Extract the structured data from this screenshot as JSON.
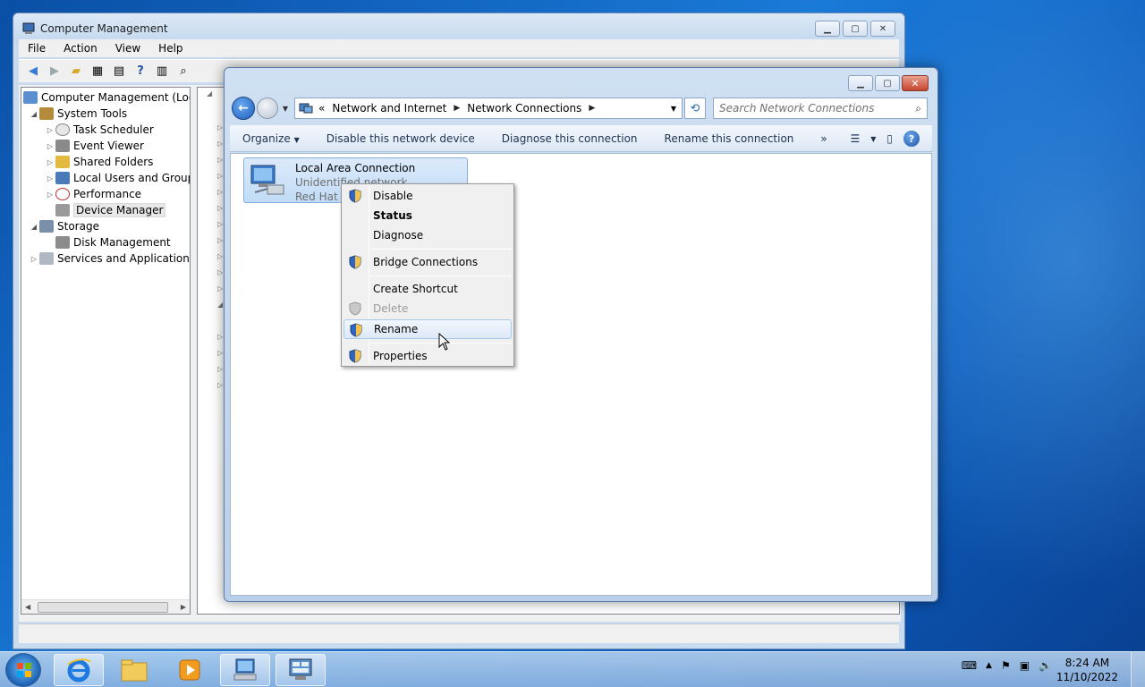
{
  "colors": {
    "desktop": "#1a7ad8",
    "selection": "#c1dcf6",
    "menu_hover": "#dde9f8",
    "close_button": "#c6452f"
  },
  "computer_management": {
    "title": "Computer Management",
    "menu": [
      "File",
      "Action",
      "View",
      "Help"
    ],
    "toolbar_icons": [
      "back-arrow-icon",
      "forward-arrow-icon",
      "up-folder-icon",
      "show-hide-tree-icon",
      "properties-icon",
      "help-icon",
      "action-pane-icon",
      "scan-hardware-icon"
    ],
    "tree": [
      {
        "label": "Computer Management (Local",
        "icon": "computer-icon"
      },
      {
        "label": "System Tools",
        "icon": "tools-icon"
      },
      {
        "label": "Task Scheduler",
        "icon": "clock-icon"
      },
      {
        "label": "Event Viewer",
        "icon": "event-viewer-icon"
      },
      {
        "label": "Shared Folders",
        "icon": "shared-folder-icon"
      },
      {
        "label": "Local Users and Groups",
        "icon": "users-icon"
      },
      {
        "label": "Performance",
        "icon": "performance-icon"
      },
      {
        "label": "Device Manager",
        "icon": "device-manager-icon"
      },
      {
        "label": "Storage",
        "icon": "storage-icon"
      },
      {
        "label": "Disk Management",
        "icon": "disk-icon"
      },
      {
        "label": "Services and Applications",
        "icon": "services-icon"
      }
    ],
    "scroll_glyph": "III",
    "selected_node": "Device Manager"
  },
  "network_connections": {
    "breadcrumb_prefix": "«",
    "breadcrumb": [
      "Network and Internet",
      "Network Connections"
    ],
    "search_placeholder": "Search Network Connections",
    "commands": {
      "organize": "Organize",
      "disable": "Disable this network device",
      "diagnose": "Diagnose this connection",
      "rename": "Rename this connection",
      "more": "»"
    },
    "connection": {
      "name": "Local Area Connection",
      "status": "Unidentified network",
      "device": "Red Hat V"
    }
  },
  "context_menu": {
    "items": [
      {
        "label": "Disable",
        "shield": true
      },
      {
        "label": "Status",
        "bold": true
      },
      {
        "label": "Diagnose"
      },
      {
        "label": "Bridge Connections",
        "shield": true
      },
      {
        "label": "Create Shortcut"
      },
      {
        "label": "Delete",
        "disabled": true,
        "shield": true
      },
      {
        "label": "Rename",
        "shield": true,
        "hover": true
      },
      {
        "label": "Properties",
        "shield": true
      }
    ]
  },
  "taskbar": {
    "apps": [
      "internet-explorer-icon",
      "windows-explorer-icon",
      "media-player-icon",
      "network-connections-icon",
      "computer-management-icon"
    ],
    "clock": {
      "time": "8:24 AM",
      "date": "11/10/2022"
    }
  }
}
